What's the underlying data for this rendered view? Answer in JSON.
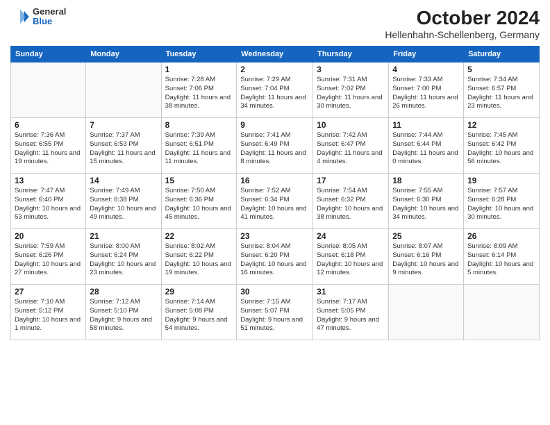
{
  "header": {
    "logo_general": "General",
    "logo_blue": "Blue",
    "title": "October 2024",
    "subtitle": "Hellenhahn-Schellenberg, Germany"
  },
  "weekdays": [
    "Sunday",
    "Monday",
    "Tuesday",
    "Wednesday",
    "Thursday",
    "Friday",
    "Saturday"
  ],
  "weeks": [
    [
      {
        "day": "",
        "info": ""
      },
      {
        "day": "",
        "info": ""
      },
      {
        "day": "1",
        "info": "Sunrise: 7:28 AM\nSunset: 7:06 PM\nDaylight: 11 hours and 38 minutes."
      },
      {
        "day": "2",
        "info": "Sunrise: 7:29 AM\nSunset: 7:04 PM\nDaylight: 11 hours and 34 minutes."
      },
      {
        "day": "3",
        "info": "Sunrise: 7:31 AM\nSunset: 7:02 PM\nDaylight: 11 hours and 30 minutes."
      },
      {
        "day": "4",
        "info": "Sunrise: 7:33 AM\nSunset: 7:00 PM\nDaylight: 11 hours and 26 minutes."
      },
      {
        "day": "5",
        "info": "Sunrise: 7:34 AM\nSunset: 6:57 PM\nDaylight: 11 hours and 23 minutes."
      }
    ],
    [
      {
        "day": "6",
        "info": "Sunrise: 7:36 AM\nSunset: 6:55 PM\nDaylight: 11 hours and 19 minutes."
      },
      {
        "day": "7",
        "info": "Sunrise: 7:37 AM\nSunset: 6:53 PM\nDaylight: 11 hours and 15 minutes."
      },
      {
        "day": "8",
        "info": "Sunrise: 7:39 AM\nSunset: 6:51 PM\nDaylight: 11 hours and 11 minutes."
      },
      {
        "day": "9",
        "info": "Sunrise: 7:41 AM\nSunset: 6:49 PM\nDaylight: 11 hours and 8 minutes."
      },
      {
        "day": "10",
        "info": "Sunrise: 7:42 AM\nSunset: 6:47 PM\nDaylight: 11 hours and 4 minutes."
      },
      {
        "day": "11",
        "info": "Sunrise: 7:44 AM\nSunset: 6:44 PM\nDaylight: 11 hours and 0 minutes."
      },
      {
        "day": "12",
        "info": "Sunrise: 7:45 AM\nSunset: 6:42 PM\nDaylight: 10 hours and 56 minutes."
      }
    ],
    [
      {
        "day": "13",
        "info": "Sunrise: 7:47 AM\nSunset: 6:40 PM\nDaylight: 10 hours and 53 minutes."
      },
      {
        "day": "14",
        "info": "Sunrise: 7:49 AM\nSunset: 6:38 PM\nDaylight: 10 hours and 49 minutes."
      },
      {
        "day": "15",
        "info": "Sunrise: 7:50 AM\nSunset: 6:36 PM\nDaylight: 10 hours and 45 minutes."
      },
      {
        "day": "16",
        "info": "Sunrise: 7:52 AM\nSunset: 6:34 PM\nDaylight: 10 hours and 41 minutes."
      },
      {
        "day": "17",
        "info": "Sunrise: 7:54 AM\nSunset: 6:32 PM\nDaylight: 10 hours and 38 minutes."
      },
      {
        "day": "18",
        "info": "Sunrise: 7:55 AM\nSunset: 6:30 PM\nDaylight: 10 hours and 34 minutes."
      },
      {
        "day": "19",
        "info": "Sunrise: 7:57 AM\nSunset: 6:28 PM\nDaylight: 10 hours and 30 minutes."
      }
    ],
    [
      {
        "day": "20",
        "info": "Sunrise: 7:59 AM\nSunset: 6:26 PM\nDaylight: 10 hours and 27 minutes."
      },
      {
        "day": "21",
        "info": "Sunrise: 8:00 AM\nSunset: 6:24 PM\nDaylight: 10 hours and 23 minutes."
      },
      {
        "day": "22",
        "info": "Sunrise: 8:02 AM\nSunset: 6:22 PM\nDaylight: 10 hours and 19 minutes."
      },
      {
        "day": "23",
        "info": "Sunrise: 8:04 AM\nSunset: 6:20 PM\nDaylight: 10 hours and 16 minutes."
      },
      {
        "day": "24",
        "info": "Sunrise: 8:05 AM\nSunset: 6:18 PM\nDaylight: 10 hours and 12 minutes."
      },
      {
        "day": "25",
        "info": "Sunrise: 8:07 AM\nSunset: 6:16 PM\nDaylight: 10 hours and 9 minutes."
      },
      {
        "day": "26",
        "info": "Sunrise: 8:09 AM\nSunset: 6:14 PM\nDaylight: 10 hours and 5 minutes."
      }
    ],
    [
      {
        "day": "27",
        "info": "Sunrise: 7:10 AM\nSunset: 5:12 PM\nDaylight: 10 hours and 1 minute."
      },
      {
        "day": "28",
        "info": "Sunrise: 7:12 AM\nSunset: 5:10 PM\nDaylight: 9 hours and 58 minutes."
      },
      {
        "day": "29",
        "info": "Sunrise: 7:14 AM\nSunset: 5:08 PM\nDaylight: 9 hours and 54 minutes."
      },
      {
        "day": "30",
        "info": "Sunrise: 7:15 AM\nSunset: 5:07 PM\nDaylight: 9 hours and 51 minutes."
      },
      {
        "day": "31",
        "info": "Sunrise: 7:17 AM\nSunset: 5:05 PM\nDaylight: 9 hours and 47 minutes."
      },
      {
        "day": "",
        "info": ""
      },
      {
        "day": "",
        "info": ""
      }
    ]
  ]
}
